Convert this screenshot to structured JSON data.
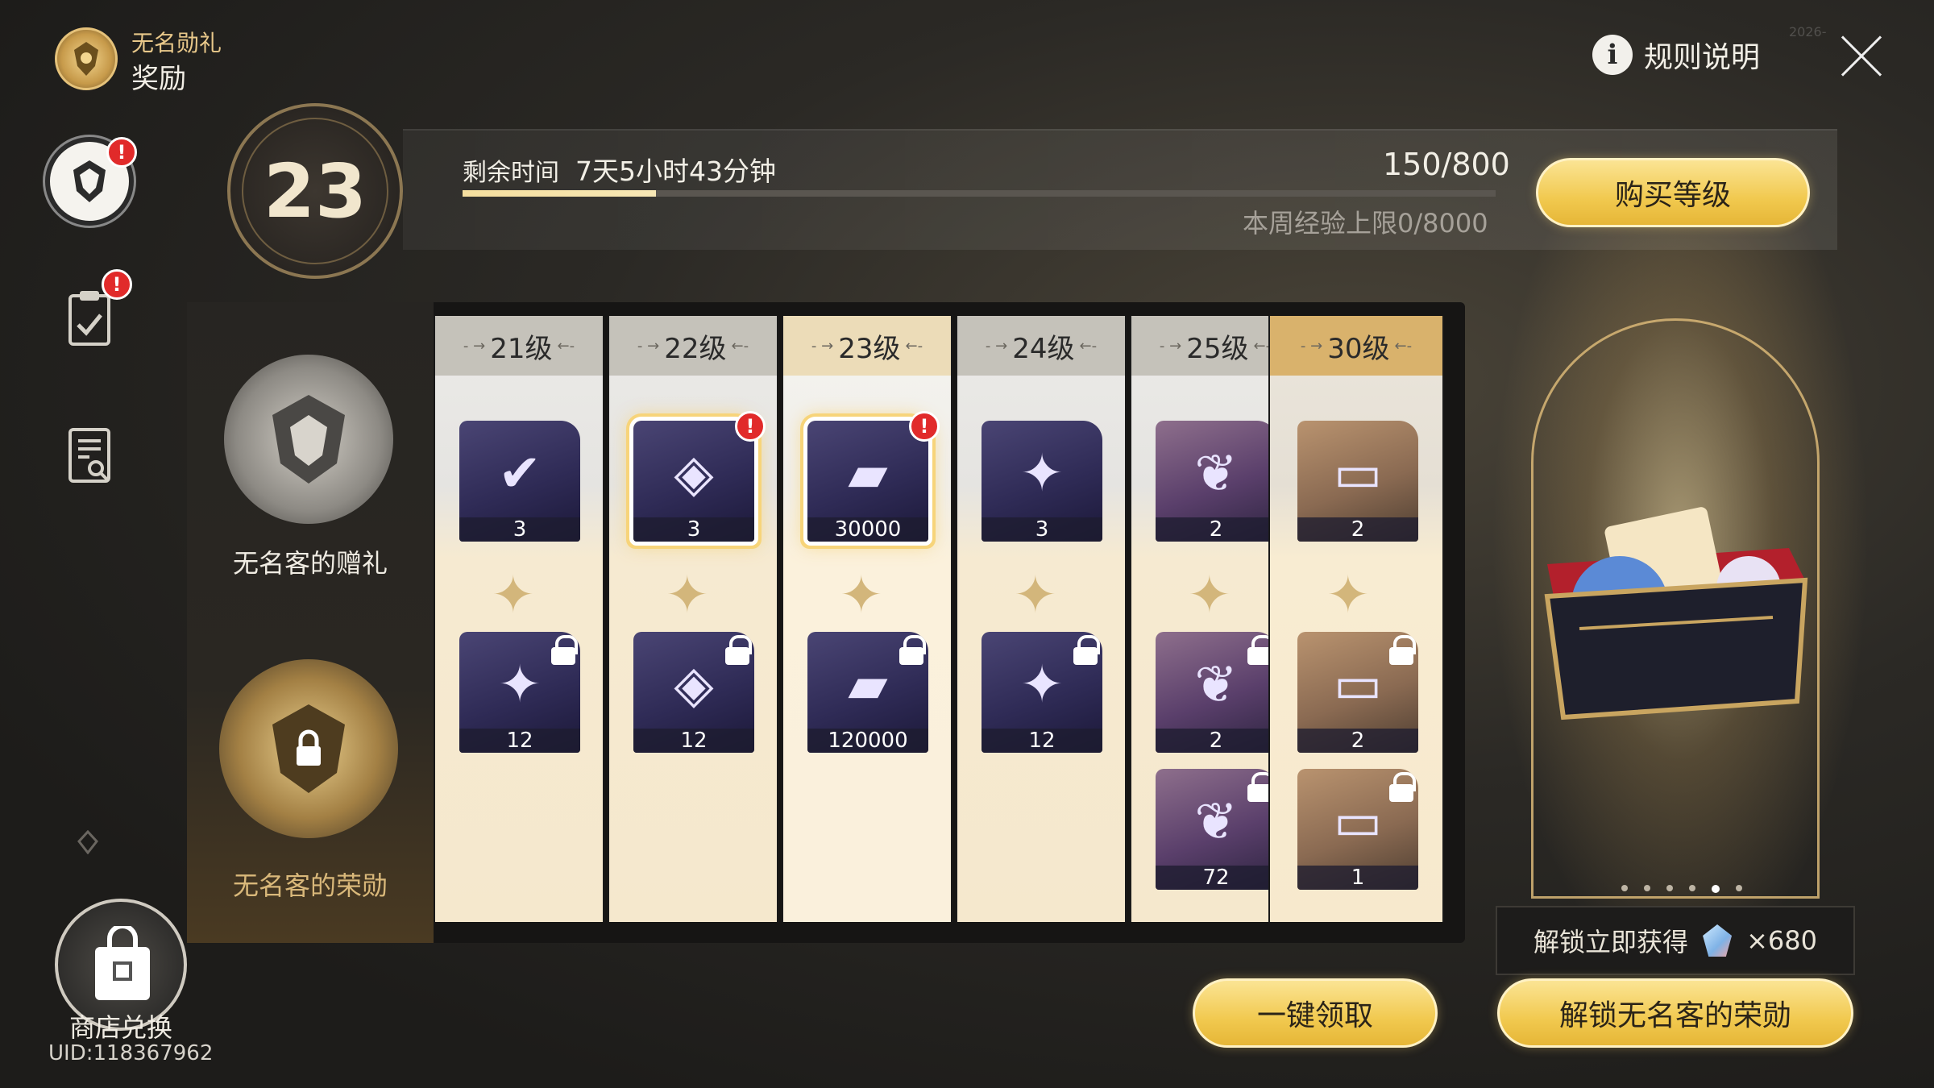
{
  "header": {
    "small_title": "无名勋礼",
    "big_title": "奖励",
    "rules_label": "规则说明"
  },
  "level": {
    "current": "23",
    "remaining_label": "剩余时间",
    "remaining_value": "7天5小时43分钟",
    "exp": "150/800",
    "exp_progress": 0.1875,
    "weekly": "本周经验上限0/8000",
    "buy_label": "购买等级"
  },
  "tiers": {
    "free": "无名客的赠礼",
    "paid": "无名客的荣勋"
  },
  "columns": [
    {
      "level": "21级",
      "free": [
        {
          "qty": "3",
          "claimed": true
        }
      ],
      "paid": [
        {
          "qty": "12"
        }
      ]
    },
    {
      "level": "22级",
      "free": [
        {
          "qty": "3",
          "alert": true
        }
      ],
      "paid": [
        {
          "qty": "12"
        }
      ]
    },
    {
      "level": "23级",
      "free": [
        {
          "qty": "30000",
          "alert": true
        }
      ],
      "paid": [
        {
          "qty": "120000"
        }
      ]
    },
    {
      "level": "24级",
      "free": [
        {
          "qty": "3"
        }
      ],
      "paid": [
        {
          "qty": "12"
        }
      ]
    },
    {
      "level": "25级",
      "free": [
        {
          "qty": "2"
        }
      ],
      "paid": [
        {
          "qty": "2"
        },
        {
          "qty": "72"
        }
      ]
    },
    {
      "level": "30级",
      "free": [
        {
          "qty": "2"
        }
      ],
      "paid": [
        {
          "qty": "2"
        },
        {
          "qty": "1"
        }
      ]
    }
  ],
  "badge_text": "!",
  "unlock_tip": {
    "label": "解锁立即获得",
    "amount": "×680"
  },
  "buttons": {
    "claim_all": "一键领取",
    "unlock": "解锁无名客的荣勋"
  },
  "shop": {
    "label": "商店兑换",
    "uid": "UID:118367962"
  },
  "stamp": "2026-"
}
